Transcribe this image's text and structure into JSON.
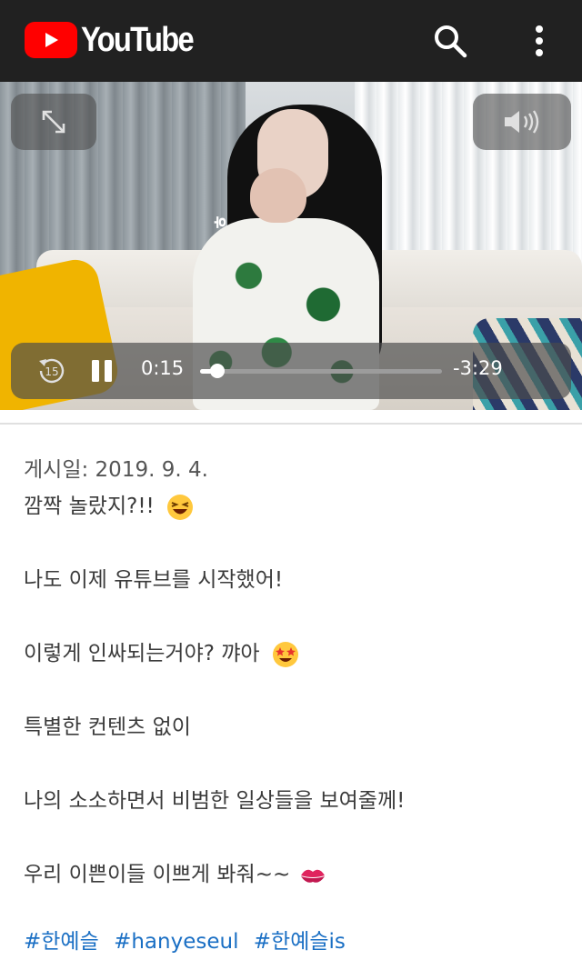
{
  "app": {
    "brand": "YouTube",
    "colors": {
      "brand_red": "#FF0000",
      "topbar": "#212121",
      "link": "#1A6FC4"
    },
    "icons": {
      "search": "search-icon",
      "menu": "more-vert-icon"
    }
  },
  "player": {
    "current_time": "0:15",
    "remaining_time": "-3:29",
    "progress": 0.07,
    "state": "playing",
    "controls": {
      "fullscreen": "fullscreen-icon",
      "volume": "volume-icon",
      "replay": "replay-15-icon",
      "replay_seconds": "15",
      "pause": "pause-icon"
    },
    "overlay_caption": "ㅎ"
  },
  "description": {
    "posted_label": "게시일:",
    "posted_date": "2019. 9. 4.",
    "lines": [
      "깜짝 놀랐지?!!",
      "나도 이제 유튜브를 시작했어!",
      "이렇게 인싸되는거야? 꺄아",
      "특별한 컨텐츠 없이",
      "나의 소소하면서 비범한 일상들을 보여줄께!",
      "우리 이쁜이들 이쁘게 봐줘~~"
    ],
    "emojis": [
      "laughing-emoji",
      "star-struck-emoji",
      "kiss-mark-emoji"
    ],
    "hashtags": [
      "#한예슬",
      "#hanyeseul",
      "#한예슬is"
    ]
  }
}
